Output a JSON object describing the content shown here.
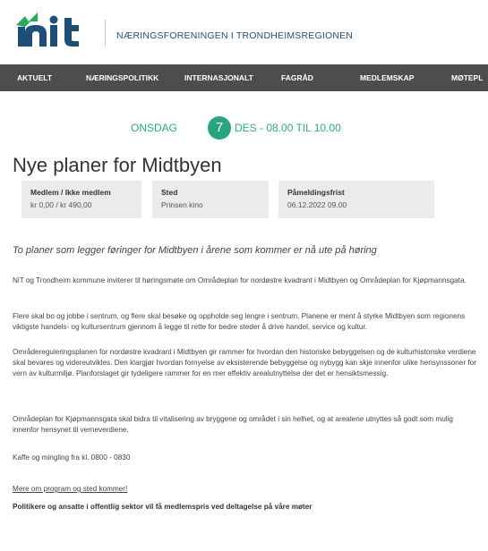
{
  "header": {
    "logo_text": "nit",
    "tagline": "NÆRINGSFORENINGEN I TRONDHEIMSREGIONEN"
  },
  "nav": {
    "items": [
      "AKTUELT",
      "NÆRINGSPOLITIKK",
      "INTERNASJONALT",
      "FAGRÅD",
      "MEDLEMSKAP",
      "MØTEPL"
    ]
  },
  "event": {
    "weekday": "ONSDAG",
    "day": "7",
    "rest": "DES - 08.00 TIL 10.00",
    "title": "Nye planer for Midtbyen",
    "info": [
      {
        "label": "Medlem / Ikke medlem",
        "value": "kr 0,00 / kr 490,00"
      },
      {
        "label": "Sted",
        "value": "Prinsen kino"
      },
      {
        "label": "Påmeldingsfrist",
        "value": "06.12.2022 09.00"
      }
    ],
    "lead": "To planer som legger føringer for Midtbyen i årene som kommer er nå ute på høring",
    "paragraphs": [
      "NiT og Trondheim kommune inviterer til høringsmøte om Områdeplan for nordøstre kvadrant i Midtbyen og Områdeplan for Kjøpmannsgata.",
      "Flere skal bo og jobbe i sentrum, og flere skal besøke og oppholde seg lengre i sentrum. Planene er ment å styrke Midtbyen som regionens viktigste handels- og kultursentrum gjennom å legge til rette for bedre steder å drive handel, service og kultur.",
      "Områdereguleringsplanen for nordøstre kvadrant i Midtbyen gir rammer for hvordan den historiske bebyggelsen og de kulturhistoriske verdiene skal bevares og videreutvikles. Den klargjør hvordan fornyelse av eksisterende bebyggelse og nybygg kan skje innenfor ulike hensynssoner for vern av kulturmiljø. Planforslaget gir tydeligere rammer for en mer effektiv arealutnyttelse der det er hensiktsmessig.",
      "Områdeplan for Kjøpmannsgata skal bidra til vitalisering av bryggene og området i sin helhet, og at arealene utnyttes så godt som mulig innenfor hensynet til verneverdiene.",
      "Kaffe og mingling fra kl. 0800 - 0830"
    ],
    "link_text": "Mere om program og sted kommer!",
    "bold_note": "Politikere og ansatte i offentlig sektor vil få medlemspris ved deltagelse på våre møter"
  },
  "colors": {
    "accent": "#27a583",
    "nav_bg": "#4d4d4d",
    "logo_blue": "#1f4e79"
  }
}
